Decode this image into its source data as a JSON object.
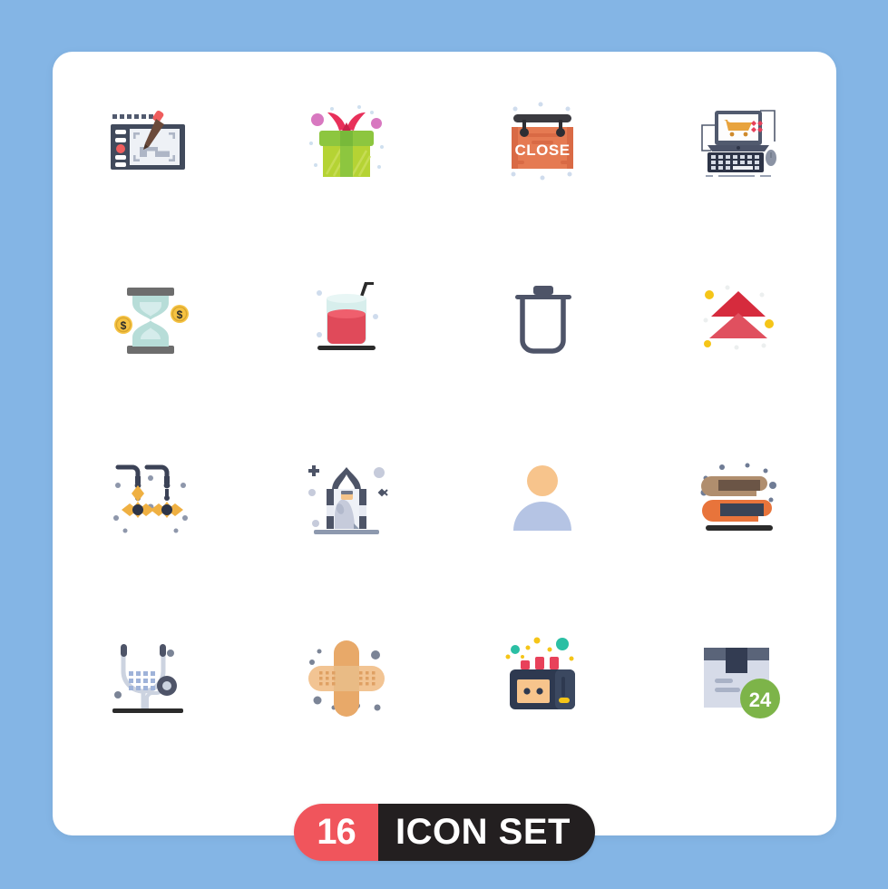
{
  "canvas": {
    "background_color": "#84b5e5",
    "card_color": "#ffffff"
  },
  "footer": {
    "count": "16",
    "title": "ICON SET",
    "count_bg": "#f0555c",
    "title_bg": "#231f20",
    "text_color": "#ffffff"
  },
  "grid": {
    "rows": 4,
    "columns": 4,
    "total_icons": 16
  },
  "icons": [
    {
      "index": 1,
      "name": "graphic-tablet",
      "label": "Graphic Tablet",
      "row": 1,
      "col": 1,
      "colors": [
        "#414a5c",
        "#e8ebf0",
        "#8d99ae",
        "#ef5d5d",
        "#6b4a3a"
      ]
    },
    {
      "index": 2,
      "name": "gift-box",
      "label": "Gift Box",
      "row": 1,
      "col": 2,
      "colors": [
        "#a8cf3c",
        "#7ac143",
        "#e8305a",
        "#d878c0"
      ]
    },
    {
      "index": 3,
      "name": "close-sign",
      "label": "Close Sign",
      "row": 1,
      "col": 3,
      "sign_text": "CLOSE",
      "colors": [
        "#e57a52",
        "#3a3a40",
        "#ffffff"
      ]
    },
    {
      "index": 4,
      "name": "online-shopping",
      "label": "Online Shopping",
      "row": 1,
      "col": 4,
      "colors": [
        "#515a6e",
        "#e8a33d",
        "#e8415a",
        "#2d3447"
      ]
    },
    {
      "index": 5,
      "name": "time-is-money",
      "label": "Time Is Money",
      "row": 2,
      "col": 1,
      "colors": [
        "#b7ddd8",
        "#6d6d6d",
        "#f5c242",
        "#2b2b2b"
      ]
    },
    {
      "index": 6,
      "name": "juice-glass",
      "label": "Juice Glass",
      "row": 2,
      "col": 2,
      "colors": [
        "#d7eeec",
        "#e04a5a",
        "#2b2b2b"
      ]
    },
    {
      "index": 7,
      "name": "trash-bin",
      "label": "Trash Bin",
      "row": 2,
      "col": 3,
      "colors": [
        "#4e5468",
        "#ffffff"
      ]
    },
    {
      "index": 8,
      "name": "up-arrows",
      "label": "Up Arrows",
      "row": 2,
      "col": 4,
      "colors": [
        "#d62b3d",
        "#e0505f",
        "#f5c518"
      ]
    },
    {
      "index": 9,
      "name": "earrings",
      "label": "Earrings",
      "row": 3,
      "col": 1,
      "colors": [
        "#3b4256",
        "#efb042",
        "#8e97ab"
      ]
    },
    {
      "index": 10,
      "name": "praying-muslim",
      "label": "Praying Muslim",
      "row": 3,
      "col": 2,
      "colors": [
        "#4d5467",
        "#c6cbdb",
        "#f5c48a",
        "#8d99ae"
      ]
    },
    {
      "index": 11,
      "name": "user-avatar",
      "label": "User Avatar",
      "row": 3,
      "col": 3,
      "colors": [
        "#f7c48c",
        "#b5c4e4"
      ]
    },
    {
      "index": 12,
      "name": "book-stack",
      "label": "Book Stack",
      "row": 3,
      "col": 4,
      "colors": [
        "#b08e6e",
        "#6b5546",
        "#e8743b",
        "#3a4456",
        "#2b2b2b"
      ]
    },
    {
      "index": 13,
      "name": "stethoscope",
      "label": "Stethoscope",
      "row": 4,
      "col": 1,
      "colors": [
        "#ccd3e0",
        "#7b8496",
        "#9fb3d9",
        "#2b2b2b"
      ]
    },
    {
      "index": 14,
      "name": "bandage-cross",
      "label": "Bandage Cross",
      "row": 4,
      "col": 2,
      "colors": [
        "#e8a969",
        "#f2c493",
        "#7b8496"
      ]
    },
    {
      "index": 15,
      "name": "tape-recorder",
      "label": "Tape Recorder",
      "row": 4,
      "col": 3,
      "colors": [
        "#2e3950",
        "#f7c48c",
        "#e8415a",
        "#2bbfa4",
        "#f5c518"
      ]
    },
    {
      "index": 16,
      "name": "delivery-box-24h",
      "label": "24 Hour Delivery",
      "row": 4,
      "col": 4,
      "badge_text": "24",
      "colors": [
        "#d6dbe8",
        "#5a6479",
        "#333c52",
        "#7db449"
      ]
    }
  ]
}
